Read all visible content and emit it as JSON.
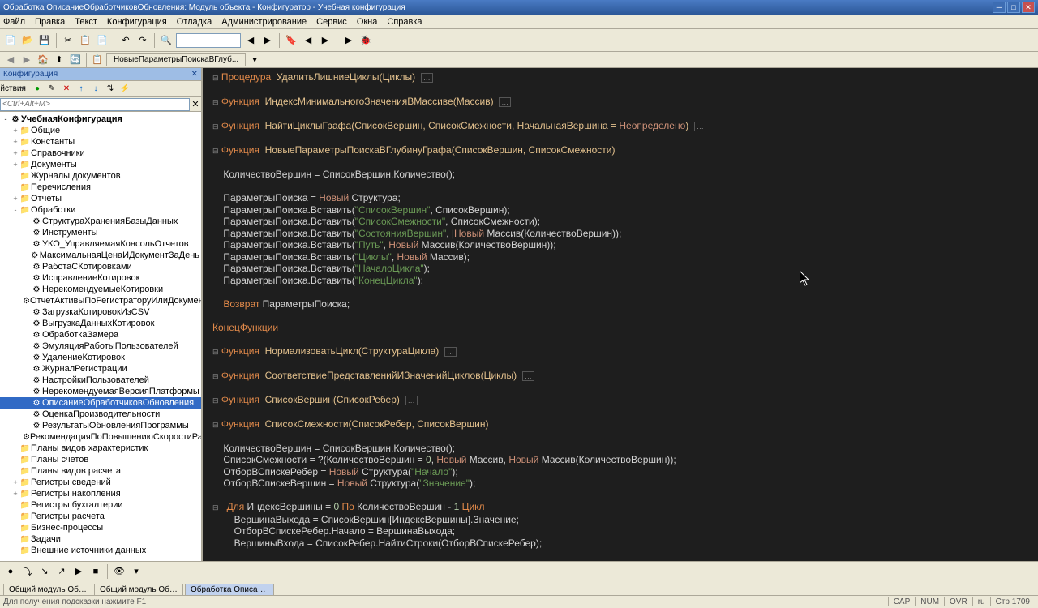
{
  "title": "Обработка ОписаниеОбработчиковОбновления: Модуль объекта - Конфигуратор - Учебная конфигурация",
  "menu": [
    "Файл",
    "Правка",
    "Текст",
    "Конфигурация",
    "Отладка",
    "Администрирование",
    "Сервис",
    "Окна",
    "Справка"
  ],
  "panel_title": "Конфигурация",
  "panel_actions": "Действия",
  "tree_filter_placeholder": "<Ctrl+Alt+M>",
  "doc_tab": "НовыеПараметрыПоискаВГлуб...",
  "tree": {
    "root": "УчебнаяКонфигурация",
    "sections": [
      {
        "name": "Общие",
        "exp": "+"
      },
      {
        "name": "Константы",
        "exp": "+"
      },
      {
        "name": "Справочники",
        "exp": "+"
      },
      {
        "name": "Документы",
        "exp": "+"
      },
      {
        "name": "Журналы документов",
        "exp": ""
      },
      {
        "name": "Перечисления",
        "exp": ""
      },
      {
        "name": "Отчеты",
        "exp": "+"
      },
      {
        "name": "Обработки",
        "exp": "-",
        "children": [
          "СтруктураХраненияБазыДанных",
          "Инструменты",
          "УКО_УправляемаяКонсольОтчетов",
          "МаксимальнаяЦенаИДокументЗаДень",
          "РаботаСКотировками",
          "ИсправлениеКотировок",
          "НерекомендуемыеКотировки",
          "ОтчетАктивыПоРегистраторуИлиДокументуПокупки",
          "ЗагрузкаКотировокИзCSV",
          "ВыгрузкаДанныхКотировок",
          "ОбработкаЗамера",
          "ЭмуляцияРаботыПользователей",
          "УдалениеКотировок",
          "ЖурналРегистрации",
          "НастройкиПользователей",
          "НерекомендуемаяВерсияПлатформы",
          "ОписаниеОбработчиковОбновления",
          "ОценкаПроизводительности",
          "РезультатыОбновленияПрограммы",
          "РекомендацияПоПовышениюСкоростиРаботы"
        ]
      },
      {
        "name": "Планы видов характеристик",
        "exp": ""
      },
      {
        "name": "Планы счетов",
        "exp": ""
      },
      {
        "name": "Планы видов расчета",
        "exp": ""
      },
      {
        "name": "Регистры сведений",
        "exp": "+"
      },
      {
        "name": "Регистры накопления",
        "exp": "+"
      },
      {
        "name": "Регистры бухгалтерии",
        "exp": ""
      },
      {
        "name": "Регистры расчета",
        "exp": ""
      },
      {
        "name": "Бизнес-процессы",
        "exp": ""
      },
      {
        "name": "Задачи",
        "exp": ""
      },
      {
        "name": "Внешние источники данных",
        "exp": ""
      }
    ],
    "selected": "ОписаниеОбработчиковОбновления"
  },
  "code": {
    "l1": {
      "kw": "Процедура",
      "fn": "УдалитьЛишниеЦиклы(Циклы)"
    },
    "l2": {
      "kw": "Функция",
      "fn": "ИндексМинимальногоЗначенияВМассиве(Массив)"
    },
    "l3": {
      "kw": "Функция",
      "fn": "НайтиЦиклыГрафа(СписокВершин, СписокСмежности, НачальнаяВершина = ",
      "c": "Неопределено",
      "close": ")"
    },
    "l4": {
      "kw": "Функция",
      "fn": "НовыеПараметрыПоискаВГлубинуГрафа(СписокВершин, СписокСмежности)"
    },
    "l5": "    КоличествоВершин = СписокВершин.Количество();",
    "l6": {
      "t": "    ПараметрыПоиска = ",
      "n": "Новый",
      "r": " Структура;"
    },
    "l7": {
      "t": "    ПараметрыПоиска.Вставить(",
      "s": "\"СписокВершин\"",
      "r": ", СписокВершин);"
    },
    "l8": {
      "t": "    ПараметрыПоиска.Вставить(",
      "s": "\"СписокСмежности\"",
      "r": ", СписокСмежности);"
    },
    "l9": {
      "t": "    ПараметрыПоиска.Вставить(",
      "s": "\"СостоянияВершин\"",
      "r": ", |",
      "n": "Новый",
      "r2": " Массив(КоличествоВершин));"
    },
    "l10": {
      "t": "    ПараметрыПоиска.Вставить(",
      "s": "\"Путь\"",
      "r": ", ",
      "n": "Новый",
      "r2": " Массив(КоличествоВершин));"
    },
    "l11": {
      "t": "    ПараметрыПоиска.Вставить(",
      "s": "\"Циклы\"",
      "r": ", ",
      "n": "Новый",
      "r2": " Массив);"
    },
    "l12": {
      "t": "    ПараметрыПоиска.Вставить(",
      "s": "\"НачалоЦикла\"",
      "r": ");"
    },
    "l13": {
      "t": "    ПараметрыПоиска.Вставить(",
      "s": "\"КонецЦикла\"",
      "r": ");"
    },
    "l14": {
      "kw": "Возврат",
      "r": " ПараметрыПоиска;"
    },
    "l15": "КонецФункции",
    "l16": {
      "kw": "Функция",
      "fn": "НормализоватьЦикл(СтруктураЦикла)"
    },
    "l17": {
      "kw": "Функция",
      "fn": "СоответствиеПредставленийИЗначенийЦиклов(Циклы)"
    },
    "l18": {
      "kw": "Функция",
      "fn": "СписокВершин(СписокРебер)"
    },
    "l19": {
      "kw": "Функция",
      "fn": "СписокСмежности(СписокРебер, СписокВершин)"
    },
    "l20": "    КоличествоВершин = СписокВершин.Количество();",
    "l21": {
      "t": "    СписокСмежности = ?(КоличествоВершин = ",
      "num": "0",
      "r": ", ",
      "n": "Новый",
      "r2": " Массив, ",
      "n2": "Новый",
      "r3": " Массив(КоличествоВершин));"
    },
    "l22": {
      "t": "    ОтборВСпискеРебер = ",
      "n": "Новый",
      "r": " Структура(",
      "s": "\"Начало\"",
      "r2": ");"
    },
    "l23": {
      "t": "    ОтборВСпискеВершин = ",
      "n": "Новый",
      "r": " Структура(",
      "s": "\"Значение\"",
      "r2": ");"
    },
    "l24": {
      "kw": "Для",
      "t": " ИндексВершины = ",
      "num": "0",
      "kw2": "По",
      "t2": " КоличествоВершин - ",
      "num2": "1",
      "kw3": "Цикл"
    },
    "l25": "        ВершинаВыхода = СписокВершин[ИндексВершины].Значение;",
    "l26": "        ОтборВСпискеРебер.Начало = ВершинаВыхода;",
    "l27": "        ВершиныВхода = СписокРебер.НайтиСтроки(ОтборВСпискеРебер);"
  },
  "bottom_tabs": [
    "Общий модуль Обновлени...",
    "Общий модуль ОбщегоНа...",
    "Обработка ОписаниеОбра..."
  ],
  "status": {
    "hint": "Для получения подсказки нажмите F1",
    "caps": "CAP",
    "num": "NUM",
    "ovr": "OVR",
    "l1": "ru",
    "l2": "Стр 1709"
  }
}
